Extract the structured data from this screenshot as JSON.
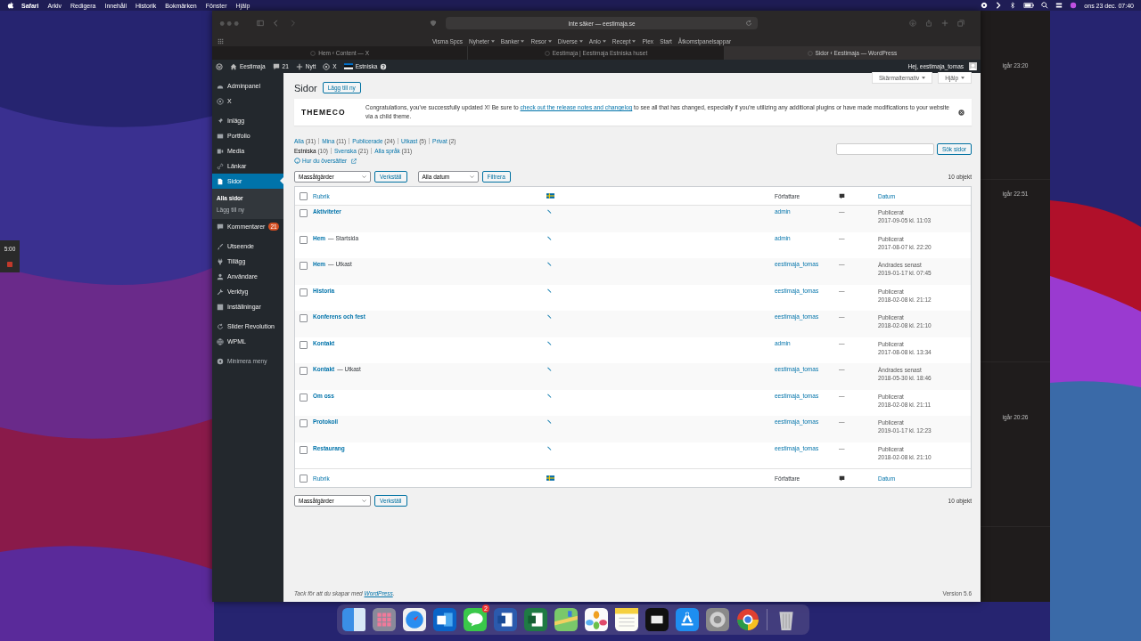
{
  "menubar": {
    "app": "Safari",
    "menus": [
      "Arkiv",
      "Redigera",
      "Innehåll",
      "Historik",
      "Bokmärken",
      "Fönster",
      "Hjälp"
    ],
    "clock": "ons 23 dec. 07:40"
  },
  "desktop_widget": {
    "time": "5:00"
  },
  "back_window": {
    "times": [
      "igår 23:20",
      "igår 22:51",
      "igår 20:26"
    ]
  },
  "browser": {
    "address": "Inte säker — eestimaja.se",
    "bookmarks": [
      {
        "label": "Visma Spcs",
        "menu": false
      },
      {
        "label": "Nyheter",
        "menu": true
      },
      {
        "label": "Banker",
        "menu": true
      },
      {
        "label": "Resor",
        "menu": true
      },
      {
        "label": "Diverse",
        "menu": true
      },
      {
        "label": "Anlo",
        "menu": true
      },
      {
        "label": "Recept",
        "menu": true
      },
      {
        "label": "Plex",
        "menu": false
      },
      {
        "label": "Start",
        "menu": false
      },
      {
        "label": "Åtkomstpanelsappar",
        "menu": false
      }
    ],
    "tabs": [
      {
        "title": "Hem ‹ Content — X",
        "selected": false
      },
      {
        "title": "Eestimaja | Eestimaja Estniska huset",
        "selected": false
      },
      {
        "title": "Sidor ‹ Eestimaja — WordPress",
        "selected": true
      }
    ]
  },
  "admin_bar": {
    "site": "Eestimaja",
    "comments": "21",
    "new": "Nytt",
    "theme": "X",
    "language": "Estniska",
    "greeting": "Hej, eestimaja_tomas"
  },
  "sidebar": {
    "groups": [
      [
        {
          "label": "Adminpanel",
          "selected": false
        },
        {
          "label": "X",
          "selected": false
        }
      ],
      [
        {
          "label": "Inlägg",
          "selected": false
        },
        {
          "label": "Portfolio",
          "selected": false
        },
        {
          "label": "Media",
          "selected": false
        },
        {
          "label": "Länkar",
          "selected": false
        },
        {
          "label": "Sidor",
          "selected": true,
          "children": [
            {
              "label": "Alla sidor",
              "selected": true
            },
            {
              "label": "Lägg till ny",
              "selected": false
            }
          ]
        },
        {
          "label": "Kommentarer",
          "selected": false,
          "badge": "21"
        }
      ],
      [
        {
          "label": "Utseende",
          "selected": false
        },
        {
          "label": "Tillägg",
          "selected": false
        },
        {
          "label": "Användare",
          "selected": false
        },
        {
          "label": "Verktyg",
          "selected": false
        },
        {
          "label": "Inställningar",
          "selected": false
        }
      ],
      [
        {
          "label": "Slider Revolution",
          "selected": false
        },
        {
          "label": "WPML",
          "selected": false
        }
      ]
    ],
    "collapse": "Minimera meny"
  },
  "page": {
    "title": "Sidor",
    "add_new": "Lägg till ny",
    "screen_options": "Skärmalternativ",
    "help": "Hjälp",
    "notice": {
      "logo": "THEMECO",
      "before": "Congratulations, you've successfully updated X! Be sure to ",
      "link": "check out the release notes and changelog",
      "after": " to see all that has changed, especially if you're utilizing any additional plugins or have made modifications to your website via a child theme."
    },
    "status_filters": [
      {
        "label": "Alla",
        "count": "(31)",
        "selected": false
      },
      {
        "label": "Mina",
        "count": "(11)",
        "selected": false
      },
      {
        "label": "Publicerade",
        "count": "(24)",
        "selected": false
      },
      {
        "label": "Utkast",
        "count": "(5)",
        "selected": false
      },
      {
        "label": "Privat",
        "count": "(2)",
        "selected": false
      }
    ],
    "language_filters": [
      {
        "label": "Estniska",
        "count": "(10)",
        "selected": true
      },
      {
        "label": "Svenska",
        "count": "(21)",
        "selected": false
      },
      {
        "label": "Alla språk",
        "count": "(31)",
        "selected": false
      }
    ],
    "translate_link": "Hur du översätter",
    "search_button": "Sök sidor",
    "top_actions": {
      "bulk": "Massåtgärder",
      "apply": "Verkställ",
      "date": "Alla datum",
      "filter": "Filtrera",
      "count": "10 objekt"
    },
    "columns": {
      "title": "Rubrik",
      "author": "Författare",
      "date": "Datum",
      "select_all_checked": false
    },
    "footer_columns": {
      "title": "Rubrik",
      "author": "Författare",
      "date": "Datum",
      "select_all_checked": false
    },
    "rows": [
      {
        "title": "Aktiviteter",
        "author": "admin",
        "comments": "—",
        "status": "Publicerat",
        "date": "2017-09-05 kl. 11:03",
        "checked": false
      },
      {
        "title": "Hem",
        "state": "— Startsida",
        "author": "admin",
        "comments": "—",
        "status": "Publicerat",
        "date": "2017-08-07 kl. 22:20",
        "checked": false
      },
      {
        "title": "Hem",
        "state": "— Utkast",
        "author": "eestimaja_tomas",
        "comments": "—",
        "status": "Ändrades senast",
        "date": "2019-01-17 kl. 07:45",
        "checked": false
      },
      {
        "title": "Historia",
        "author": "eestimaja_tomas",
        "comments": "—",
        "status": "Publicerat",
        "date": "2018-02-08 kl. 21:12",
        "checked": false
      },
      {
        "title": "Konferens och fest",
        "author": "eestimaja_tomas",
        "comments": "—",
        "status": "Publicerat",
        "date": "2018-02-08 kl. 21:10",
        "checked": false
      },
      {
        "title": "Kontakt",
        "author": "admin",
        "comments": "—",
        "status": "Publicerat",
        "date": "2017-08-08 kl. 13:34",
        "checked": false
      },
      {
        "title": "Kontakt",
        "state": "— Utkast",
        "author": "eestimaja_tomas",
        "comments": "—",
        "status": "Ändrades senast",
        "date": "2018-05-30 kl. 18:46",
        "checked": false
      },
      {
        "title": "Om oss",
        "author": "eestimaja_tomas",
        "comments": "—",
        "status": "Publicerat",
        "date": "2018-02-08 kl. 21:11",
        "checked": false
      },
      {
        "title": "Protokoll",
        "author": "eestimaja_tomas",
        "comments": "—",
        "status": "Publicerat",
        "date": "2019-01-17 kl. 12:23",
        "checked": false
      },
      {
        "title": "Restaurang",
        "author": "eestimaja_tomas",
        "comments": "—",
        "status": "Publicerat",
        "date": "2018-02-08 kl. 21:10",
        "checked": false
      }
    ],
    "bottom_actions": {
      "bulk": "Massåtgärder",
      "apply": "Verkställ",
      "count": "10 objekt"
    },
    "footer": {
      "before": "Tack för att du skapar med ",
      "link": "WordPress",
      "after": ".",
      "version": "Version 5.6"
    }
  },
  "dock": {
    "messages_badge": "2"
  }
}
